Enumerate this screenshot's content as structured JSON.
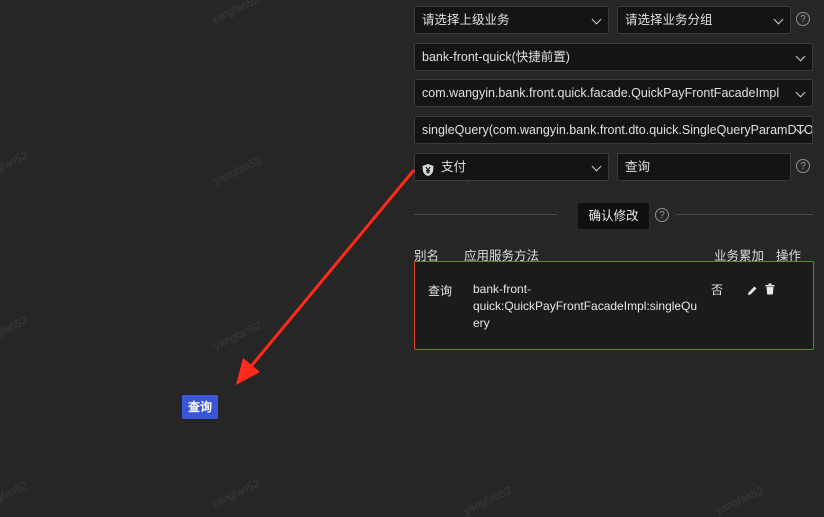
{
  "watermark": "yangfan52",
  "form": {
    "parent_business_placeholder": "请选择上级业务",
    "business_group_placeholder": "请选择业务分组",
    "app_select": "bank-front-quick(快捷前置)",
    "service_select": "com.wangyin.bank.front.quick.facade.QuickPayFrontFacadeImpl",
    "method_select": "singleQuery(com.wangyin.bank.front.dto.quick.SingleQueryParamDTO)",
    "business_select": "支付",
    "alias_value": "查询",
    "help_glyph": "?",
    "confirm_button": "确认修改"
  },
  "table": {
    "headers": {
      "alias": "别名",
      "method": "应用服务方法",
      "accumulate": "业务累加",
      "action": "操作"
    },
    "rows": [
      {
        "alias": "查询",
        "method_line1": "bank-front-",
        "method_line2": "quick:QuickPayFrontFacadeImpl:singleQu",
        "method_line3": "ery",
        "accumulate": "否"
      }
    ]
  },
  "canvas_node": {
    "label": "查询",
    "color": "#3b55d8"
  },
  "arrow": {
    "color": "#ff2a1a"
  },
  "icons": {
    "dropdown": "chevron-down-icon",
    "help": "question-circle-icon",
    "business": "yen-shield-icon",
    "edit": "pencil-icon",
    "delete": "trash-icon"
  }
}
